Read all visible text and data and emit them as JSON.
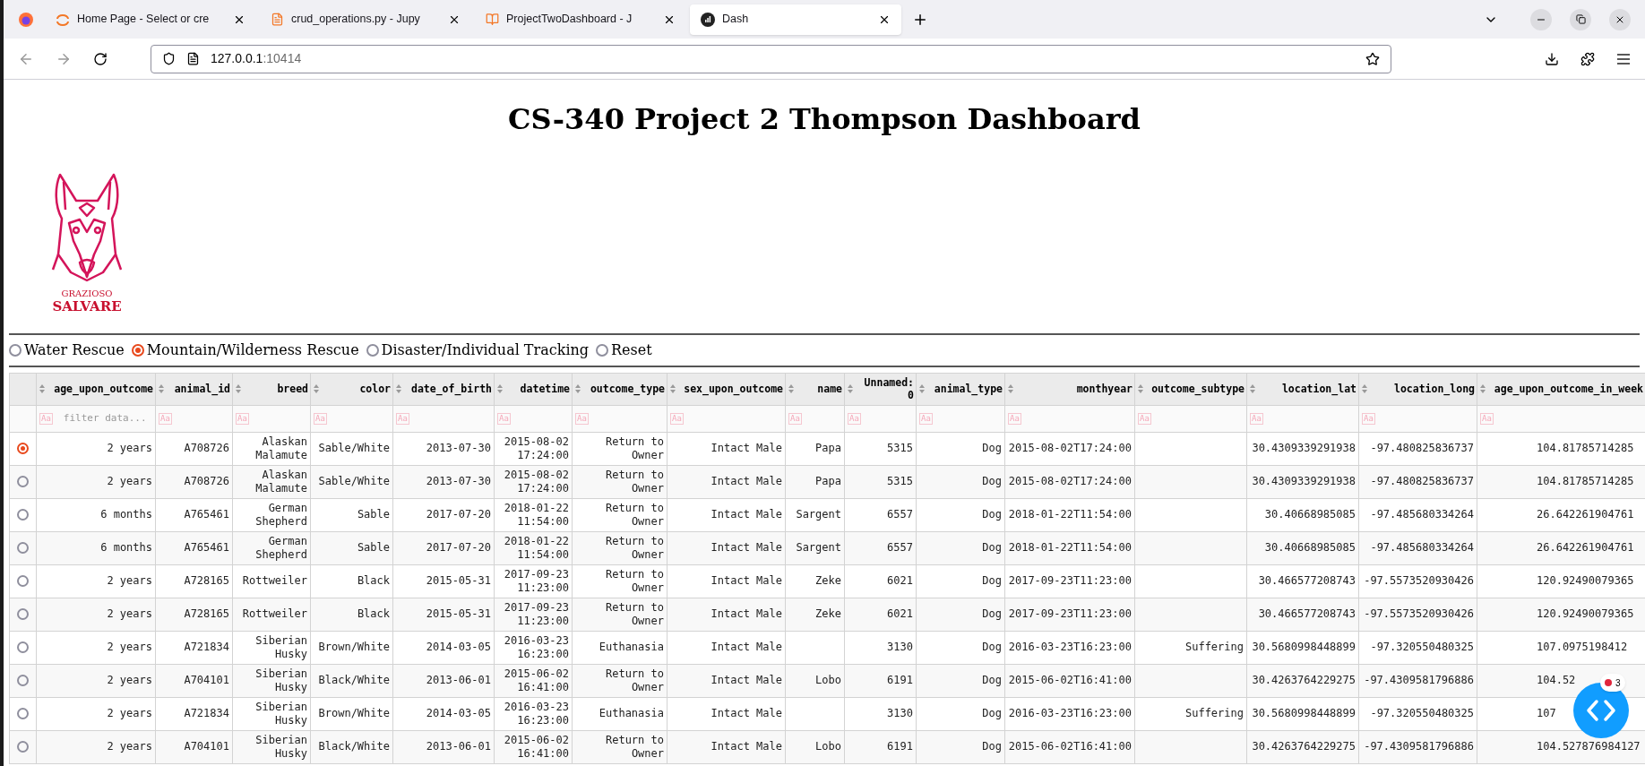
{
  "browser": {
    "tabs": [
      {
        "title": "Home Page - Select or cre",
        "selected": false,
        "kind": "jupyter"
      },
      {
        "title": "crud_operations.py - Jupy",
        "selected": false,
        "kind": "file"
      },
      {
        "title": "ProjectTwoDashboard - J",
        "selected": false,
        "kind": "notebook"
      },
      {
        "title": "Dash",
        "selected": true,
        "kind": "dash"
      }
    ],
    "url_host": "127.0.0.1",
    "url_port": ":10414"
  },
  "page": {
    "title": "CS-340 Project 2 Thompson Dashboard",
    "logo": {
      "line_1": "GRAZIOSO",
      "line_2": "SALVARE"
    },
    "rescue_options": [
      {
        "label": "Water Rescue",
        "selected": false
      },
      {
        "label": "Mountain/Wilderness Rescue",
        "selected": true
      },
      {
        "label": "Disaster/Individual Tracking",
        "selected": false
      },
      {
        "label": "Reset",
        "selected": false
      }
    ],
    "table": {
      "columns": [
        "age_upon_outcome",
        "animal_id",
        "breed",
        "color",
        "date_of_birth",
        "datetime",
        "outcome_type",
        "sex_upon_outcome",
        "name",
        "Unnamed: 0",
        "animal_type",
        "monthyear",
        "outcome_subtype",
        "location_lat",
        "location_long",
        "age_upon_outcome_in_week"
      ],
      "filters": [
        {
          "toggle": "Aa",
          "placeholder": "filter data..."
        },
        {
          "toggle": "Aa"
        },
        {
          "toggle": "Aa"
        },
        {
          "toggle": "Aa"
        },
        {
          "toggle": "Aa"
        },
        {
          "toggle": "Aa"
        },
        {
          "toggle": "Aa"
        },
        {
          "toggle": "Aa"
        },
        {
          "toggle": "Aa"
        },
        {
          "toggle": "Aa"
        },
        {
          "toggle": "Aa"
        },
        {
          "toggle": "Aa"
        },
        {
          "toggle": "Aa"
        },
        {
          "toggle": "Aa"
        },
        {
          "toggle": "Aa"
        },
        {
          "toggle": "Aa"
        }
      ],
      "rows": [
        {
          "selected": true,
          "cells": [
            "2 years",
            "A708726",
            "Alaskan Malamute",
            "Sable/White",
            "2013-07-30",
            "2015-08-02 17:24:00",
            "Return to Owner",
            "Intact Male",
            "Papa",
            "5315",
            "Dog",
            "2015-08-02T17:24:00",
            "",
            "30.4309339291938",
            "-97.480825836737",
            "104.81785714285"
          ]
        },
        {
          "selected": false,
          "cells": [
            "2 years",
            "A708726",
            "Alaskan Malamute",
            "Sable/White",
            "2013-07-30",
            "2015-08-02 17:24:00",
            "Return to Owner",
            "Intact Male",
            "Papa",
            "5315",
            "Dog",
            "2015-08-02T17:24:00",
            "",
            "30.4309339291938",
            "-97.480825836737",
            "104.81785714285"
          ]
        },
        {
          "selected": false,
          "cells": [
            "6 months",
            "A765461",
            "German Shepherd",
            "Sable",
            "2017-07-20",
            "2018-01-22 11:54:00",
            "Return to Owner",
            "Intact Male",
            "Sargent",
            "6557",
            "Dog",
            "2018-01-22T11:54:00",
            "",
            "30.40668985085",
            "-97.485680334264",
            "26.642261904761"
          ]
        },
        {
          "selected": false,
          "cells": [
            "6 months",
            "A765461",
            "German Shepherd",
            "Sable",
            "2017-07-20",
            "2018-01-22 11:54:00",
            "Return to Owner",
            "Intact Male",
            "Sargent",
            "6557",
            "Dog",
            "2018-01-22T11:54:00",
            "",
            "30.40668985085",
            "-97.485680334264",
            "26.642261904761"
          ]
        },
        {
          "selected": false,
          "cells": [
            "2 years",
            "A728165",
            "Rottweiler",
            "Black",
            "2015-05-31",
            "2017-09-23 11:23:00",
            "Return to Owner",
            "Intact Male",
            "Zeke",
            "6021",
            "Dog",
            "2017-09-23T11:23:00",
            "",
            "30.466577208743",
            "-97.5573520930426",
            "120.92490079365"
          ]
        },
        {
          "selected": false,
          "cells": [
            "2 years",
            "A728165",
            "Rottweiler",
            "Black",
            "2015-05-31",
            "2017-09-23 11:23:00",
            "Return to Owner",
            "Intact Male",
            "Zeke",
            "6021",
            "Dog",
            "2017-09-23T11:23:00",
            "",
            "30.466577208743",
            "-97.5573520930426",
            "120.92490079365"
          ]
        },
        {
          "selected": false,
          "cells": [
            "2 years",
            "A721834",
            "Siberian Husky",
            "Brown/White",
            "2014-03-05",
            "2016-03-23 16:23:00",
            "Euthanasia",
            "Intact Male",
            "",
            "3130",
            "Dog",
            "2016-03-23T16:23:00",
            "Suffering",
            "30.5680998448899",
            "-97.320550480325",
            "107.0975198412"
          ]
        },
        {
          "selected": false,
          "cells": [
            "2 years",
            "A704101",
            "Siberian Husky",
            "Black/White",
            "2013-06-01",
            "2015-06-02 16:41:00",
            "Return to Owner",
            "Intact Male",
            "Lobo",
            "6191",
            "Dog",
            "2015-06-02T16:41:00",
            "",
            "30.4263764229275",
            "-97.4309581796886",
            "104.52"
          ]
        },
        {
          "selected": false,
          "cells": [
            "2 years",
            "A721834",
            "Siberian Husky",
            "Brown/White",
            "2014-03-05",
            "2016-03-23 16:23:00",
            "Euthanasia",
            "Intact Male",
            "",
            "3130",
            "Dog",
            "2016-03-23T16:23:00",
            "Suffering",
            "30.5680998448899",
            "-97.320550480325",
            "107"
          ]
        },
        {
          "selected": false,
          "cells": [
            "2 years",
            "A704101",
            "Siberian Husky",
            "Black/White",
            "2013-06-01",
            "2015-06-02 16:41:00",
            "Return to Owner",
            "Intact Male",
            "Lobo",
            "6191",
            "Dog",
            "2015-06-02T16:41:00",
            "",
            "30.4263764229275",
            "-97.4309581796886",
            "104.527876984127"
          ]
        }
      ]
    }
  },
  "debug_button": {
    "error_count": "3"
  }
}
